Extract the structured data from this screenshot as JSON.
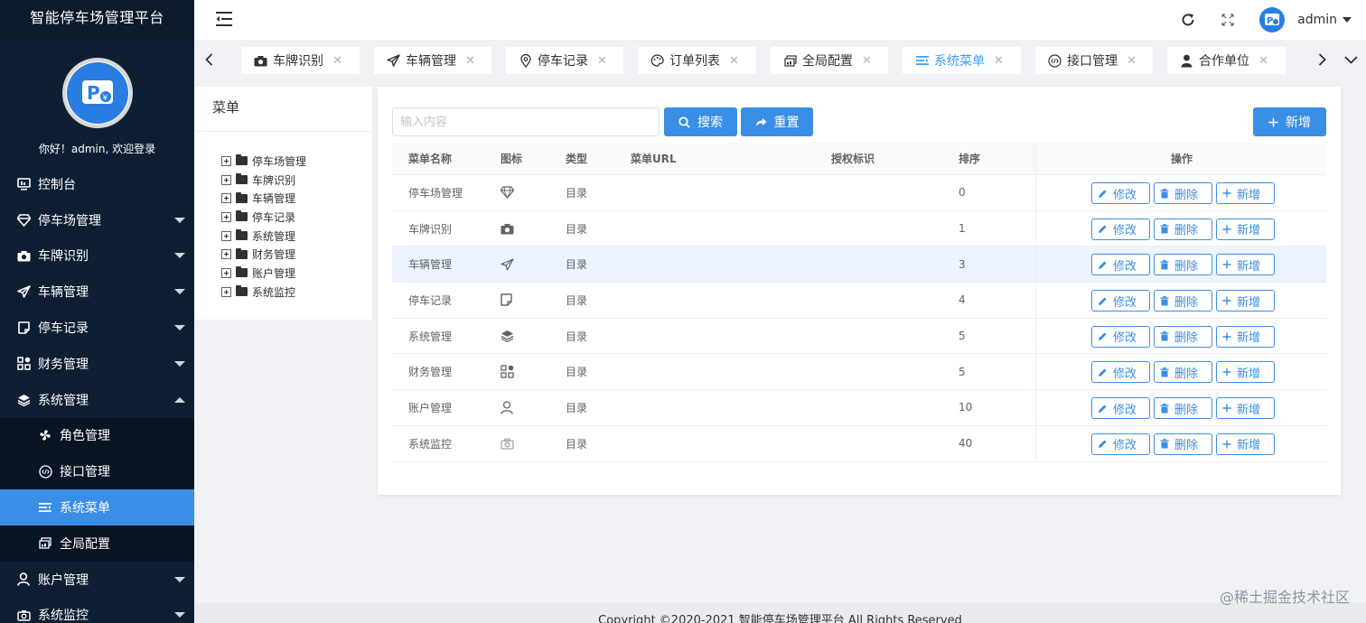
{
  "app": {
    "title": "智能停车场管理平台",
    "welcome": "你好！admin, 欢迎登录"
  },
  "sidebar": {
    "items": [
      {
        "label": "控制台",
        "icon": "monitor-icon",
        "has_caret": false
      },
      {
        "label": "停车场管理",
        "icon": "diamond-icon",
        "has_caret": true
      },
      {
        "label": "车牌识别",
        "icon": "camera-icon",
        "has_caret": true
      },
      {
        "label": "车辆管理",
        "icon": "paper-plane-icon",
        "has_caret": true
      },
      {
        "label": "停车记录",
        "icon": "note-icon",
        "has_caret": true
      },
      {
        "label": "财务管理",
        "icon": "grid-icon",
        "has_caret": true
      },
      {
        "label": "系统管理",
        "icon": "layers-icon",
        "has_caret": true,
        "expanded": true
      }
    ],
    "submenu": [
      {
        "label": "角色管理",
        "icon": "fan-icon"
      },
      {
        "label": "接口管理",
        "icon": "code-icon"
      },
      {
        "label": "系统菜单",
        "icon": "menu-list-icon",
        "active": true
      },
      {
        "label": "全局配置",
        "icon": "config-icon"
      }
    ],
    "items_after": [
      {
        "label": "账户管理",
        "icon": "user-icon",
        "has_caret": true
      },
      {
        "label": "系统监控",
        "icon": "camera-outline-icon",
        "has_caret": true
      }
    ]
  },
  "topbar": {
    "username": "admin"
  },
  "tabs": [
    {
      "label": "车牌识别",
      "icon": "camera-icon"
    },
    {
      "label": "车辆管理",
      "icon": "paper-plane-icon"
    },
    {
      "label": "停车记录",
      "icon": "location-icon"
    },
    {
      "label": "订单列表",
      "icon": "palette-icon"
    },
    {
      "label": "全局配置",
      "icon": "config-icon"
    },
    {
      "label": "系统菜单",
      "icon": "menu-list-icon",
      "active": true
    },
    {
      "label": "接口管理",
      "icon": "code-icon"
    },
    {
      "label": "合作单位",
      "icon": "user-icon"
    }
  ],
  "tree": {
    "title": "菜单",
    "items": [
      "停车场管理",
      "车牌识别",
      "车辆管理",
      "停车记录",
      "系统管理",
      "财务管理",
      "账户管理",
      "系统监控"
    ]
  },
  "toolbar": {
    "search_placeholder": "输入内容",
    "search_label": "搜索",
    "reset_label": "重置",
    "add_label": "新增"
  },
  "table": {
    "columns": {
      "name": "菜单名称",
      "icon": "图标",
      "type": "类型",
      "url": "菜单URL",
      "perm": "授权标识",
      "order": "排序",
      "ops": "操作"
    },
    "rows": [
      {
        "name": "停车场管理",
        "icon": "diamond-icon",
        "type": "目录",
        "url": "",
        "perm": "",
        "order": "0"
      },
      {
        "name": "车牌识别",
        "icon": "camera-icon",
        "type": "目录",
        "url": "",
        "perm": "",
        "order": "1"
      },
      {
        "name": "车辆管理",
        "icon": "paper-plane-icon",
        "type": "目录",
        "url": "",
        "perm": "",
        "order": "3",
        "highlight": true
      },
      {
        "name": "停车记录",
        "icon": "note-icon",
        "type": "目录",
        "url": "",
        "perm": "",
        "order": "4"
      },
      {
        "name": "系统管理",
        "icon": "layers-icon",
        "type": "目录",
        "url": "",
        "perm": "",
        "order": "5"
      },
      {
        "name": "财务管理",
        "icon": "grid-icon",
        "type": "目录",
        "url": "",
        "perm": "",
        "order": "5"
      },
      {
        "name": "账户管理",
        "icon": "user-icon",
        "type": "目录",
        "url": "",
        "perm": "",
        "order": "10"
      },
      {
        "name": "系统监控",
        "icon": "camera-outline-icon",
        "type": "目录",
        "url": "",
        "perm": "",
        "order": "40"
      }
    ],
    "ops": {
      "edit": "修改",
      "delete": "删除",
      "add": "新增"
    }
  },
  "footer": {
    "text": "Copyright ©2020-2021 智能停车场管理平台 All Rights Reserved"
  },
  "watermark": "@稀土掘金技术社区",
  "colors": {
    "sidebar_bg": "#0f1f33",
    "accent": "#3a8ee6",
    "active_tab": "#409eff"
  }
}
